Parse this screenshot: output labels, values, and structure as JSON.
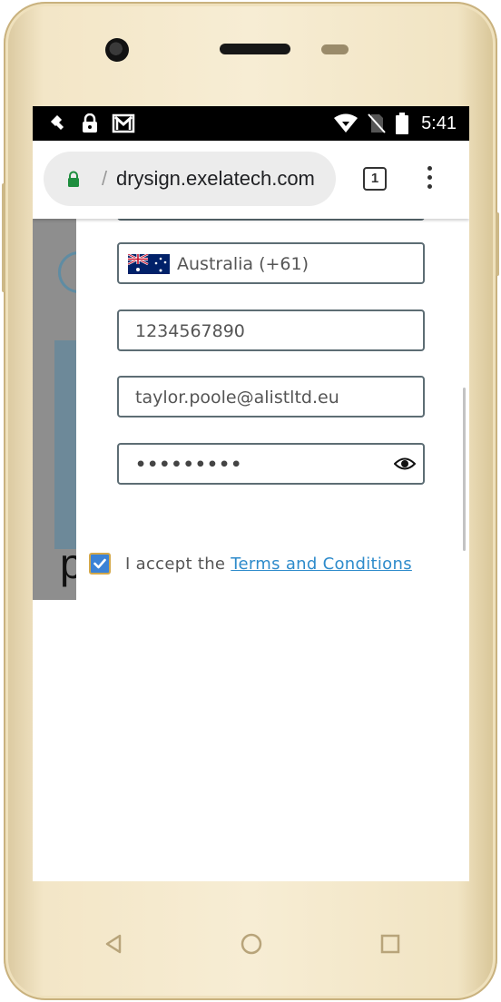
{
  "status_bar": {
    "time": "5:41",
    "icons": [
      "satellite-icon",
      "lock-icon",
      "gmail-icon",
      "wifi-icon",
      "no-sim-icon",
      "battery-icon"
    ]
  },
  "browser": {
    "url_prefix": "/",
    "url": "drysign.exelatech.com",
    "tab_count": "1"
  },
  "form": {
    "country_code": "Australia (+61)",
    "phone": "1234567890",
    "email": "taylor.poole@alistltd.eu",
    "password_masked": "•••••••••",
    "terms_prefix": "I accept the ",
    "terms_link": "Terms and Conditions",
    "terms_checked": true
  },
  "background": {
    "partial_glyph": "p"
  },
  "nav_bar": {
    "buttons": [
      "back-icon",
      "home-icon",
      "recents-icon"
    ]
  },
  "colors": {
    "accent": "#2e8bcb",
    "checkbox": "#3b82d6",
    "field_border": "#5d6d74",
    "lock_green": "#1e8e3e",
    "phone_body": "#f3e6c7"
  }
}
